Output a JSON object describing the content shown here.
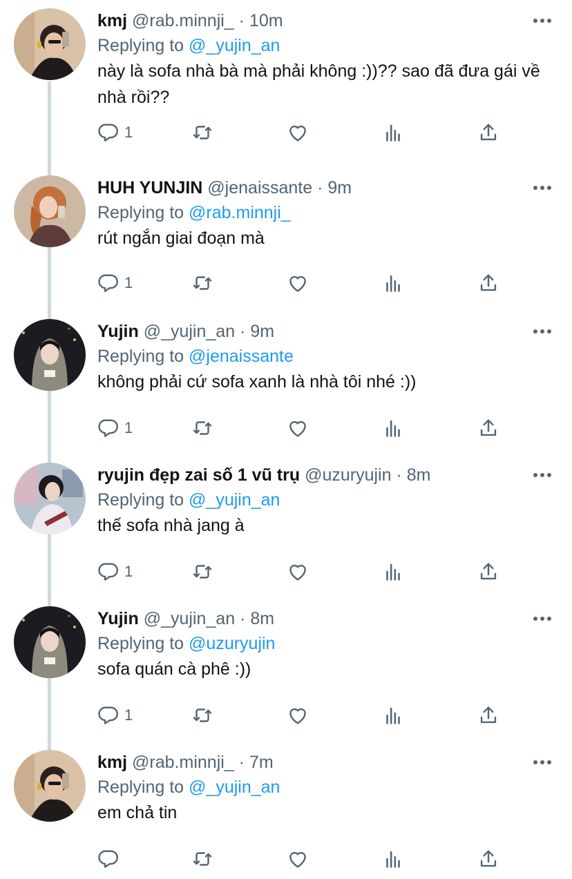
{
  "colors": {
    "link": "#1d9bf0",
    "secondary": "#536471",
    "text": "#0f1419",
    "thread_line": "#cfd9de"
  },
  "tweets": [
    {
      "avatar": "avatar-kmj",
      "name": "kmj",
      "handle": "@rab.minnji_",
      "dot": "·",
      "time": "10m",
      "replying_prefix": "Replying to",
      "replying_to": "@_yujin_an",
      "text": "này là sofa nhà bà mà phải không :))?? sao đã đưa gái về nhà rồi??",
      "reply_count": "1"
    },
    {
      "avatar": "avatar-huh-yunjin",
      "name": "HUH YUNJIN",
      "handle": "@jenaissante",
      "dot": "·",
      "time": "9m",
      "replying_prefix": "Replying to",
      "replying_to": "@rab.minnji_",
      "text": "rút ngắn giai đoạn mà",
      "reply_count": "1"
    },
    {
      "avatar": "avatar-yujin",
      "name": "Yujin",
      "handle": "@_yujin_an",
      "dot": "·",
      "time": "9m",
      "replying_prefix": "Replying to",
      "replying_to": "@jenaissante",
      "text": "không phải cứ sofa xanh là nhà tôi nhé :))",
      "reply_count": "1"
    },
    {
      "avatar": "avatar-ryujin",
      "name": "ryujin đẹp zai số 1 vũ trụ",
      "handle": "@uzuryujin",
      "dot": "·",
      "time": "8m",
      "replying_prefix": "Replying to",
      "replying_to": "@_yujin_an",
      "text": "thế sofa nhà jang à",
      "reply_count": "1"
    },
    {
      "avatar": "avatar-yujin",
      "name": "Yujin",
      "handle": "@_yujin_an",
      "dot": "·",
      "time": "8m",
      "replying_prefix": "Replying to",
      "replying_to": "@uzuryujin",
      "text": "sofa quán cà phê :))",
      "reply_count": "1"
    },
    {
      "avatar": "avatar-kmj",
      "name": "kmj",
      "handle": "@rab.minnji_",
      "dot": "·",
      "time": "7m",
      "replying_prefix": "Replying to",
      "replying_to": "@_yujin_an",
      "text": "em chả tin",
      "reply_count": ""
    }
  ],
  "icons": {
    "more": "more-horizontal-icon",
    "reply": "reply-bubble-icon",
    "retweet": "retweet-icon",
    "like": "heart-icon",
    "stats": "bar-chart-icon",
    "share": "share-upload-icon"
  }
}
